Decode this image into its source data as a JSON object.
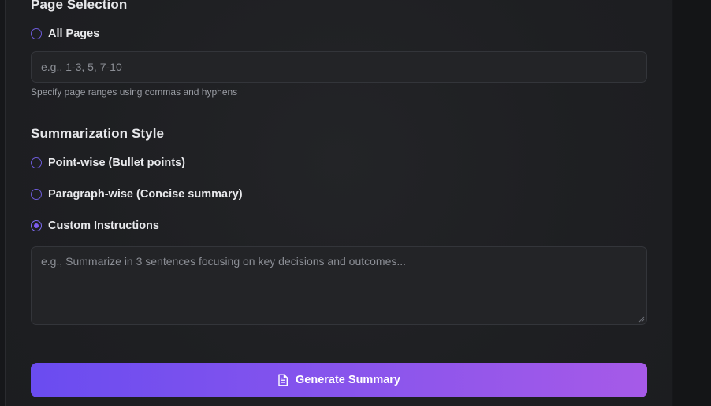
{
  "page_selection": {
    "title": "Page Selection",
    "all_pages_label": "All Pages",
    "all_pages_checked": false,
    "range_input": {
      "value": "",
      "placeholder": "e.g., 1-3, 5, 7-10"
    },
    "hint": "Specify page ranges using commas and hyphens"
  },
  "summarization_style": {
    "title": "Summarization Style",
    "options": [
      {
        "label": "Point-wise (Bullet points)",
        "checked": false
      },
      {
        "label": "Paragraph-wise (Concise summary)",
        "checked": false
      },
      {
        "label": "Custom Instructions",
        "checked": true
      }
    ],
    "custom_textarea": {
      "value": "",
      "placeholder": "e.g., Summarize in 3 sentences focusing on key decisions and outcomes..."
    }
  },
  "generate_button": {
    "label": "Generate Summary",
    "icon": "document-icon"
  },
  "colors": {
    "accent": "#7c5cf0",
    "button_gradient_start": "#6a4cf0",
    "button_gradient_end": "#a65ae8"
  }
}
